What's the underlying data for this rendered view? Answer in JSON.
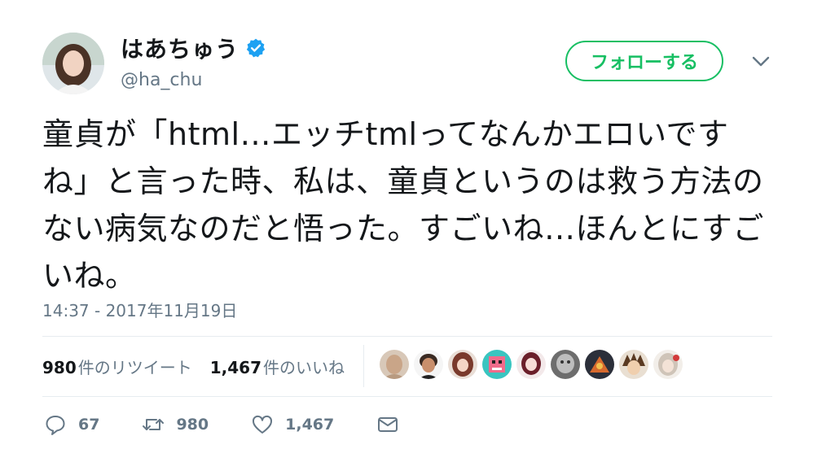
{
  "author": {
    "display_name": "はあちゅう",
    "handle": "@ha_chu",
    "verified_icon": "verified-badge-icon"
  },
  "follow_button": {
    "label": "フォローする"
  },
  "tweet": {
    "text": "童貞が「html…エッチtmlってなんかエロいですね」と言った時、私は、童貞というのは救う方法のない病気なのだと悟った。すごいね…ほんとにすごいね。",
    "timestamp": "14:37 - 2017年11月19日"
  },
  "stats": {
    "retweets_count": "980",
    "retweets_label": "件のリツイート",
    "likes_count": "1,467",
    "likes_label": "件のいいね"
  },
  "actions": {
    "reply_count": "67",
    "retweet_count": "980",
    "like_count": "1,467"
  },
  "colors": {
    "follow_green": "#17bf63",
    "verified_blue": "#1da1f2",
    "secondary_text": "#657786"
  }
}
